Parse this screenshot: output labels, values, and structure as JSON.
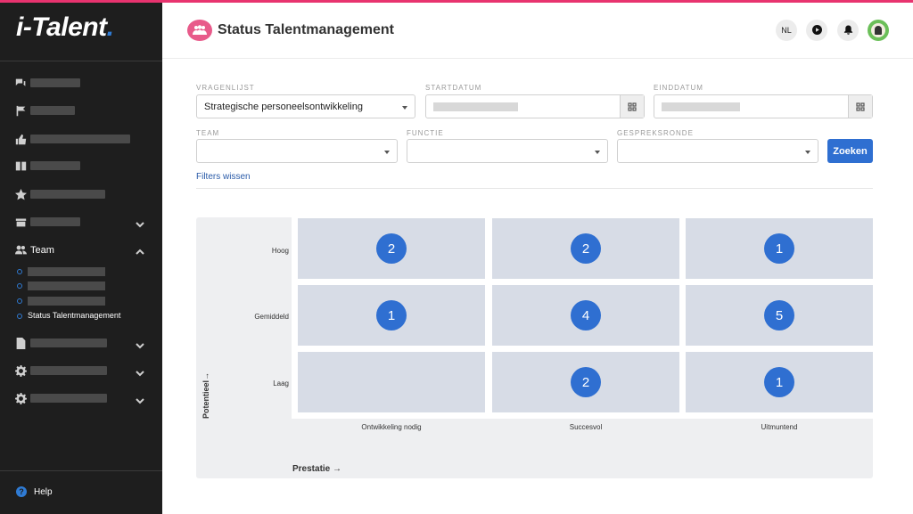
{
  "app": {
    "logo_i": "i",
    "logo_text": "-Talent",
    "logo_dot": "."
  },
  "header": {
    "title": "Status Talentmanagement",
    "lang_button": "NL"
  },
  "sidebar": {
    "team_label": "Team",
    "active_sub_label": "Status Talentmanagement",
    "help_label": "Help",
    "help_glyph": "?"
  },
  "filters": {
    "vragenlijst_label": "VRAGENLIJST",
    "vragenlijst_value": "Strategische personeelsontwikkeling",
    "startdatum_label": "STARTDATUM",
    "einddatum_label": "EINDDATUM",
    "team_label": "TEAM",
    "functie_label": "FUNCTIE",
    "gespreksronde_label": "GESPREKSRONDE",
    "search_button": "Zoeken",
    "clear_link": "Filters wissen"
  },
  "matrix": {
    "y_axis_title": "Potentieel→",
    "x_axis_title": "Prestatie →",
    "rows": [
      "Hoog",
      "Gemiddeld",
      "Laag"
    ],
    "columns": [
      "Ontwikkeling nodig",
      "Succesvol",
      "Uitmuntend"
    ],
    "counts": [
      [
        "2",
        "2",
        "1"
      ],
      [
        "1",
        "4",
        "5"
      ],
      [
        "",
        "2",
        "1"
      ]
    ]
  },
  "colors": {
    "accent": "#2f6fd1",
    "brand_pink": "#e8336f",
    "sidebar_bg": "#1e1e1e",
    "cell_bg": "#d7dce6"
  }
}
